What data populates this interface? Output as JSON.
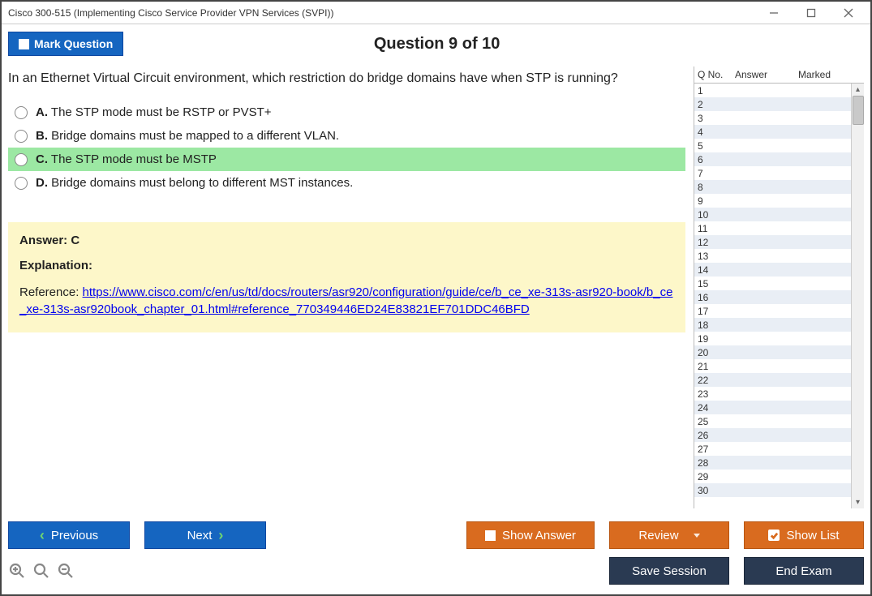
{
  "window_title": "Cisco 300-515 (Implementing Cisco Service Provider VPN Services (SVPI))",
  "header": {
    "mark_label": "Mark Question",
    "question_title": "Question 9 of 10"
  },
  "question": {
    "stem": "In an Ethernet Virtual Circuit environment, which restriction do bridge domains have when STP is running?",
    "options": [
      {
        "letter": "A.",
        "text": "The STP mode must be RSTP or PVST+",
        "selected": false
      },
      {
        "letter": "B.",
        "text": "Bridge domains must be mapped to a different VLAN.",
        "selected": false
      },
      {
        "letter": "C.",
        "text": "The STP mode must be MSTP",
        "selected": true
      },
      {
        "letter": "D.",
        "text": "Bridge domains must belong to different MST instances.",
        "selected": false
      }
    ]
  },
  "answer_panel": {
    "answer_label": "Answer: C",
    "explanation_title": "Explanation:",
    "reference_prefix": "Reference: ",
    "reference_url": "https://www.cisco.com/c/en/us/td/docs/routers/asr920/configuration/guide/ce/b_ce_xe-313s-asr920-book/b_ce_xe-313s-asr920book_chapter_01.html#reference_770349446ED24E83821EF701DDC46BFD"
  },
  "sidebar": {
    "col_q": "Q No.",
    "col_a": "Answer",
    "col_m": "Marked",
    "rows": [
      1,
      2,
      3,
      4,
      5,
      6,
      7,
      8,
      9,
      10,
      11,
      12,
      13,
      14,
      15,
      16,
      17,
      18,
      19,
      20,
      21,
      22,
      23,
      24,
      25,
      26,
      27,
      28,
      29,
      30
    ]
  },
  "footer": {
    "previous": "Previous",
    "next": "Next",
    "show_answer": "Show Answer",
    "review": "Review",
    "show_list": "Show List",
    "save_session": "Save Session",
    "end_exam": "End Exam"
  }
}
